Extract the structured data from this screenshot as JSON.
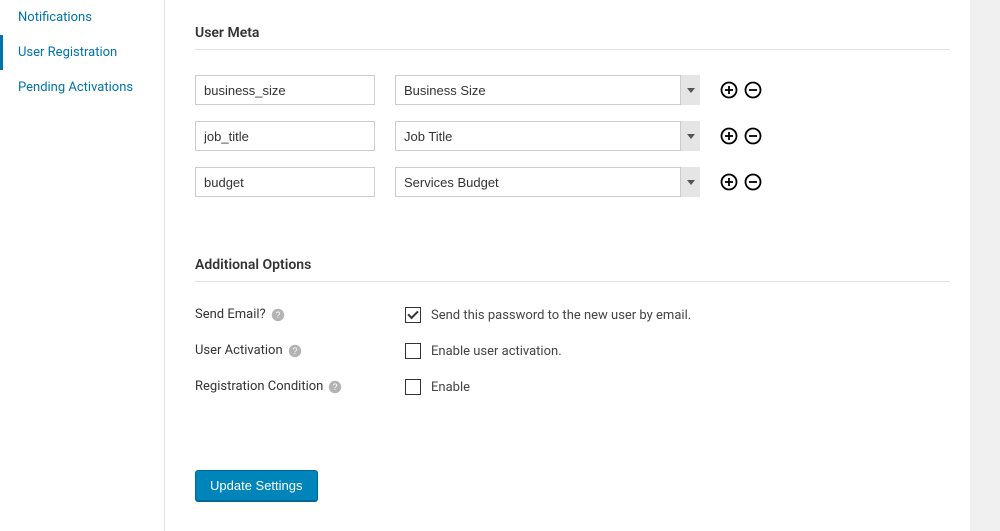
{
  "sidebar": {
    "items": [
      {
        "label": "Notifications"
      },
      {
        "label": "User Registration"
      },
      {
        "label": "Pending Activations"
      }
    ]
  },
  "sections": {
    "user_meta": {
      "title": "User Meta",
      "rows": [
        {
          "key": "business_size",
          "field": "Business Size"
        },
        {
          "key": "job_title",
          "field": "Job Title"
        },
        {
          "key": "budget",
          "field": "Services Budget"
        }
      ]
    },
    "additional": {
      "title": "Additional Options",
      "send_email": {
        "label": "Send Email?",
        "checkbox_label": "Send this password to the new user by email.",
        "checked": true
      },
      "user_activation": {
        "label": "User Activation",
        "checkbox_label": "Enable user activation.",
        "checked": false
      },
      "registration_condition": {
        "label": "Registration Condition",
        "checkbox_label": "Enable",
        "checked": false
      }
    }
  },
  "submit_label": "Update Settings"
}
